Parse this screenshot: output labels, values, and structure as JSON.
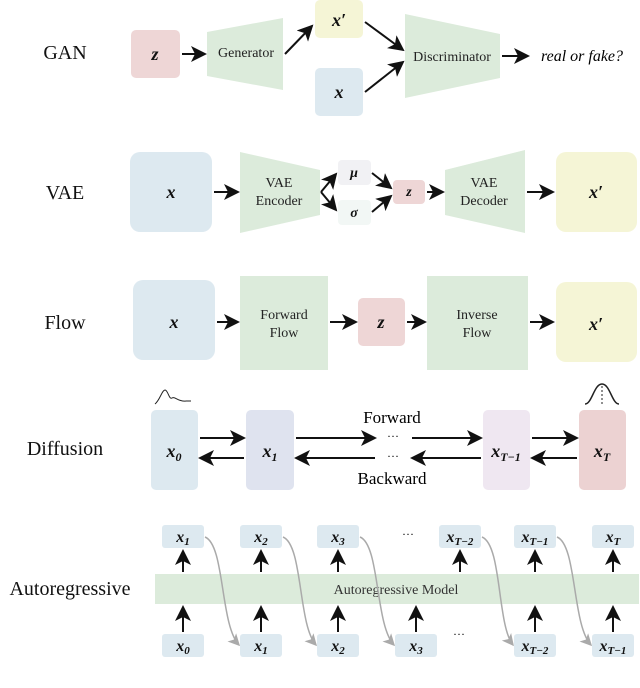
{
  "colors": {
    "blue": "#dde9f0",
    "pink": "#eed6d6",
    "yellow": "#f5f5d6",
    "green": "#dcebdb",
    "lavender": "#dfe3ef",
    "lilac": "#efe7f1",
    "grey": "#f1f1f4"
  },
  "gan": {
    "label": "GAN",
    "z": "z",
    "generator": "Generator",
    "x_prime": "x′",
    "x": "x",
    "discriminator": "Discriminator",
    "output": "real or fake?"
  },
  "vae": {
    "label": "VAE",
    "x": "x",
    "encoder_line1": "VAE",
    "encoder_line2": "Encoder",
    "mu": "μ",
    "sigma": "σ",
    "z": "z",
    "decoder_line1": "VAE",
    "decoder_line2": "Decoder",
    "x_prime": "x′"
  },
  "flow": {
    "label": "Flow",
    "x": "x",
    "forward_line1": "Forward",
    "forward_line2": "Flow",
    "z": "z",
    "inverse_line1": "Inverse",
    "inverse_line2": "Flow",
    "x_prime": "x′"
  },
  "diffusion": {
    "label": "Diffusion",
    "forward": "Forward",
    "backward": "Backward",
    "dots": "···",
    "nodes": [
      {
        "base": "x",
        "sub": "0"
      },
      {
        "base": "x",
        "sub": "1"
      },
      {
        "base": "x",
        "sub": "T−1"
      },
      {
        "base": "x",
        "sub": "T"
      }
    ]
  },
  "autoregressive": {
    "label": "Autoregressive",
    "model": "Autoregressive Model",
    "dots": "···",
    "outputs": [
      {
        "base": "x",
        "sub": "1"
      },
      {
        "base": "x",
        "sub": "2"
      },
      {
        "base": "x",
        "sub": "3"
      },
      {
        "base": "x",
        "sub": "T−2"
      },
      {
        "base": "x",
        "sub": "T−1"
      },
      {
        "base": "x",
        "sub": "T"
      }
    ],
    "inputs": [
      {
        "base": "x",
        "sub": "0"
      },
      {
        "base": "x",
        "sub": "1"
      },
      {
        "base": "x",
        "sub": "2"
      },
      {
        "base": "x",
        "sub": "3"
      },
      {
        "base": "x",
        "sub": "T−2"
      },
      {
        "base": "x",
        "sub": "T−1"
      }
    ]
  }
}
